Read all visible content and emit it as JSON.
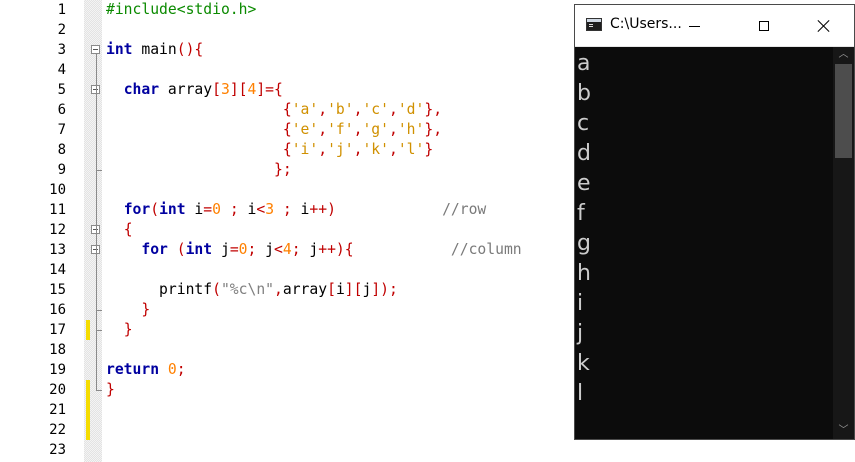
{
  "editor": {
    "lines": [
      {
        "n": "1",
        "tokens": [
          {
            "c": "pp",
            "t": "#include<stdio.h>"
          }
        ]
      },
      {
        "n": "2",
        "tokens": []
      },
      {
        "n": "3",
        "tokens": [
          {
            "c": "kw",
            "t": "int"
          },
          {
            "c": "pl",
            "t": " main"
          },
          {
            "c": "op",
            "t": "(){"
          }
        ]
      },
      {
        "n": "4",
        "tokens": []
      },
      {
        "n": "5",
        "tokens": [
          {
            "c": "pl",
            "t": "  "
          },
          {
            "c": "kw",
            "t": "char"
          },
          {
            "c": "pl",
            "t": " array"
          },
          {
            "c": "op",
            "t": "["
          },
          {
            "c": "num",
            "t": "3"
          },
          {
            "c": "op",
            "t": "]["
          },
          {
            "c": "num",
            "t": "4"
          },
          {
            "c": "op",
            "t": "]={"
          }
        ]
      },
      {
        "n": "6",
        "tokens": [
          {
            "c": "pl",
            "t": "                    "
          },
          {
            "c": "op",
            "t": "{"
          },
          {
            "c": "chr",
            "t": "'a'"
          },
          {
            "c": "op",
            "t": ","
          },
          {
            "c": "chr",
            "t": "'b'"
          },
          {
            "c": "op",
            "t": ","
          },
          {
            "c": "chr",
            "t": "'c'"
          },
          {
            "c": "op",
            "t": ","
          },
          {
            "c": "chr",
            "t": "'d'"
          },
          {
            "c": "op",
            "t": "},"
          }
        ]
      },
      {
        "n": "7",
        "tokens": [
          {
            "c": "pl",
            "t": "                    "
          },
          {
            "c": "op",
            "t": "{"
          },
          {
            "c": "chr",
            "t": "'e'"
          },
          {
            "c": "op",
            "t": ","
          },
          {
            "c": "chr",
            "t": "'f'"
          },
          {
            "c": "op",
            "t": ","
          },
          {
            "c": "chr",
            "t": "'g'"
          },
          {
            "c": "op",
            "t": ","
          },
          {
            "c": "chr",
            "t": "'h'"
          },
          {
            "c": "op",
            "t": "},"
          }
        ]
      },
      {
        "n": "8",
        "tokens": [
          {
            "c": "pl",
            "t": "                    "
          },
          {
            "c": "op",
            "t": "{"
          },
          {
            "c": "chr",
            "t": "'i'"
          },
          {
            "c": "op",
            "t": ","
          },
          {
            "c": "chr",
            "t": "'j'"
          },
          {
            "c": "op",
            "t": ","
          },
          {
            "c": "chr",
            "t": "'k'"
          },
          {
            "c": "op",
            "t": ","
          },
          {
            "c": "chr",
            "t": "'l'"
          },
          {
            "c": "op",
            "t": "}"
          }
        ]
      },
      {
        "n": "9",
        "tokens": [
          {
            "c": "pl",
            "t": "                   "
          },
          {
            "c": "op",
            "t": "};"
          }
        ]
      },
      {
        "n": "10",
        "tokens": []
      },
      {
        "n": "11",
        "tokens": [
          {
            "c": "pl",
            "t": "  "
          },
          {
            "c": "kw",
            "t": "for"
          },
          {
            "c": "op",
            "t": "("
          },
          {
            "c": "kw",
            "t": "int"
          },
          {
            "c": "pl",
            "t": " i"
          },
          {
            "c": "op",
            "t": "="
          },
          {
            "c": "num",
            "t": "0"
          },
          {
            "c": "pl",
            "t": " "
          },
          {
            "c": "op",
            "t": ";"
          },
          {
            "c": "pl",
            "t": " i"
          },
          {
            "c": "op",
            "t": "<"
          },
          {
            "c": "num",
            "t": "3"
          },
          {
            "c": "pl",
            "t": " "
          },
          {
            "c": "op",
            "t": ";"
          },
          {
            "c": "pl",
            "t": " i"
          },
          {
            "c": "op",
            "t": "++)"
          },
          {
            "c": "pl",
            "t": "            "
          },
          {
            "c": "cm",
            "t": "//row"
          }
        ]
      },
      {
        "n": "12",
        "tokens": [
          {
            "c": "pl",
            "t": "  "
          },
          {
            "c": "op",
            "t": "{"
          }
        ]
      },
      {
        "n": "13",
        "tokens": [
          {
            "c": "pl",
            "t": "    "
          },
          {
            "c": "kw",
            "t": "for"
          },
          {
            "c": "pl",
            "t": " "
          },
          {
            "c": "op",
            "t": "("
          },
          {
            "c": "kw",
            "t": "int"
          },
          {
            "c": "pl",
            "t": " j"
          },
          {
            "c": "op",
            "t": "="
          },
          {
            "c": "num",
            "t": "0"
          },
          {
            "c": "op",
            "t": ";"
          },
          {
            "c": "pl",
            "t": " j"
          },
          {
            "c": "op",
            "t": "<"
          },
          {
            "c": "num",
            "t": "4"
          },
          {
            "c": "op",
            "t": ";"
          },
          {
            "c": "pl",
            "t": " j"
          },
          {
            "c": "op",
            "t": "++){"
          },
          {
            "c": "pl",
            "t": "           "
          },
          {
            "c": "cm",
            "t": "//column"
          }
        ]
      },
      {
        "n": "14",
        "tokens": []
      },
      {
        "n": "15",
        "tokens": [
          {
            "c": "pl",
            "t": "      printf"
          },
          {
            "c": "op",
            "t": "("
          },
          {
            "c": "str",
            "t": "\"%c\\n\""
          },
          {
            "c": "op",
            "t": ","
          },
          {
            "c": "pl",
            "t": "array"
          },
          {
            "c": "op",
            "t": "["
          },
          {
            "c": "pl",
            "t": "i"
          },
          {
            "c": "op",
            "t": "]["
          },
          {
            "c": "pl",
            "t": "j"
          },
          {
            "c": "op",
            "t": "]);"
          }
        ]
      },
      {
        "n": "16",
        "tokens": [
          {
            "c": "pl",
            "t": "    "
          },
          {
            "c": "op",
            "t": "}"
          }
        ]
      },
      {
        "n": "17",
        "tokens": [
          {
            "c": "pl",
            "t": "  "
          },
          {
            "c": "op",
            "t": "}"
          }
        ]
      },
      {
        "n": "18",
        "tokens": []
      },
      {
        "n": "19",
        "tokens": [
          {
            "c": "kw",
            "t": "return"
          },
          {
            "c": "pl",
            "t": " "
          },
          {
            "c": "num",
            "t": "0"
          },
          {
            "c": "op",
            "t": ";"
          }
        ]
      },
      {
        "n": "20",
        "tokens": [
          {
            "c": "op",
            "t": "}"
          }
        ]
      },
      {
        "n": "21",
        "tokens": []
      },
      {
        "n": "22",
        "tokens": []
      },
      {
        "n": "23",
        "tokens": []
      }
    ],
    "changed_lines": [
      "17",
      "20",
      "21",
      "22"
    ],
    "fold_lines": [
      "3",
      "5",
      "12",
      "13"
    ],
    "colors": {
      "keyword": "#0000a0",
      "preprocessor": "#0b8a00",
      "number": "#ff8000",
      "char": "#d09000",
      "operator": "#c00000",
      "comment": "#7a7a7a",
      "change_marker": "#f5dc00"
    }
  },
  "console": {
    "title": "C:\\Users...",
    "output": [
      "a",
      "b",
      "c",
      "d",
      "e",
      "f",
      "g",
      "h",
      "i",
      "j",
      "k",
      "l"
    ],
    "background": "#0c0c0c",
    "text_color": "#cccccc"
  }
}
